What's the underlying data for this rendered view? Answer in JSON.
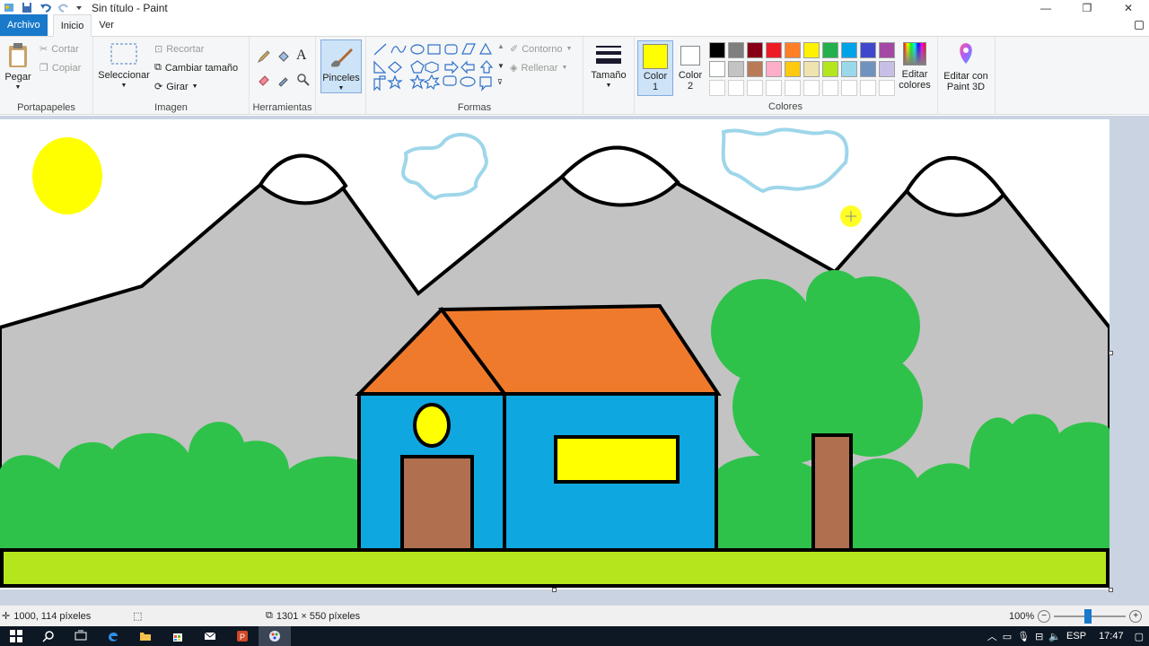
{
  "titlebar": {
    "title": "Sin título - Paint"
  },
  "tabs": {
    "file": "Archivo",
    "home": "Inicio",
    "view": "Ver"
  },
  "clipboard": {
    "paste": "Pegar",
    "cut": "Cortar",
    "copy": "Copiar",
    "label": "Portapapeles"
  },
  "image": {
    "select": "Seleccionar",
    "crop": "Recortar",
    "resize": "Cambiar tamaño",
    "rotate": "Girar",
    "label": "Imagen"
  },
  "tools": {
    "label": "Herramientas"
  },
  "brushes": {
    "label": "Pinceles"
  },
  "shapes": {
    "outline": "Contorno",
    "fill": "Rellenar",
    "label": "Formas"
  },
  "size": {
    "label": "Tamaño"
  },
  "colors": {
    "color1_label": "Color",
    "color1_num": "1",
    "color2_label": "Color",
    "color2_num": "2",
    "color1": "#ffff00",
    "color2": "#ffffff",
    "edit_colors_1": "Editar",
    "edit_colors_2": "colores",
    "label": "Colores",
    "palette": [
      "#000000",
      "#7f7f7f",
      "#880015",
      "#ed1c24",
      "#ff7f27",
      "#fff200",
      "#22b14c",
      "#00a2e8",
      "#3f48cc",
      "#a349a4",
      "#ffffff",
      "#c3c3c3",
      "#b97a57",
      "#ffaec9",
      "#ffc90e",
      "#efe4b0",
      "#b5e61d",
      "#99d9ea",
      "#7092be",
      "#c8bfe7",
      "#ffffff",
      "#ffffff",
      "#ffffff",
      "#ffffff",
      "#ffffff",
      "#ffffff",
      "#ffffff",
      "#ffffff",
      "#ffffff",
      "#ffffff"
    ]
  },
  "paint3d": {
    "line1": "Editar con",
    "line2": "Paint 3D"
  },
  "status": {
    "cursor": "1000, 114 píxeles",
    "size": "1301 × 550 píxeles",
    "zoom": "100%"
  },
  "taskbar": {
    "lang": "ESP",
    "time": "17:47"
  },
  "scene_colors": {
    "sky": "#ffffff",
    "mountain": "#c3c3c3",
    "bush": "#2fc24b",
    "ground": "#b5e61d",
    "wall": "#0fa7e0",
    "roof": "#f07a2c",
    "door": "#b07050",
    "window": "#ffff00",
    "trunk": "#b07050",
    "sun": "#ffff00",
    "cloud": "#9ed6ea"
  }
}
